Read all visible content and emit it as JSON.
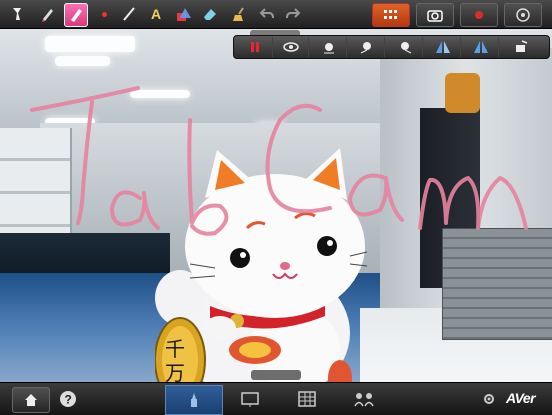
{
  "app": {
    "brand": "AVer"
  },
  "colors": {
    "accent_pink": "#e0479a",
    "record_red": "#e02a2a",
    "active_blue": "#2f5f9a",
    "scribble": "#e7839f"
  },
  "annotation": {
    "text": "TabCam"
  },
  "toolbar": {
    "icons": [
      "pointer-icon",
      "pen-icon",
      "highlighter-icon",
      "dot-icon",
      "line-icon",
      "text-icon",
      "shapes-icon",
      "eraser-icon",
      "clear-broom-icon",
      "undo-icon",
      "redo-icon",
      "freeze-icon",
      "snapshot-icon",
      "record-icon",
      "settings-icon"
    ]
  },
  "subbar": {
    "icons": [
      "pause-icon",
      "eye-icon",
      "brightness-icon",
      "brightness-low-icon",
      "brightness-high-icon",
      "flip-icon",
      "mirror-icon",
      "rotate-icon"
    ]
  },
  "bottombar": {
    "tabs": [
      "camera-tab",
      "whiteboard-tab",
      "gallery-tab",
      "share-tab"
    ]
  }
}
